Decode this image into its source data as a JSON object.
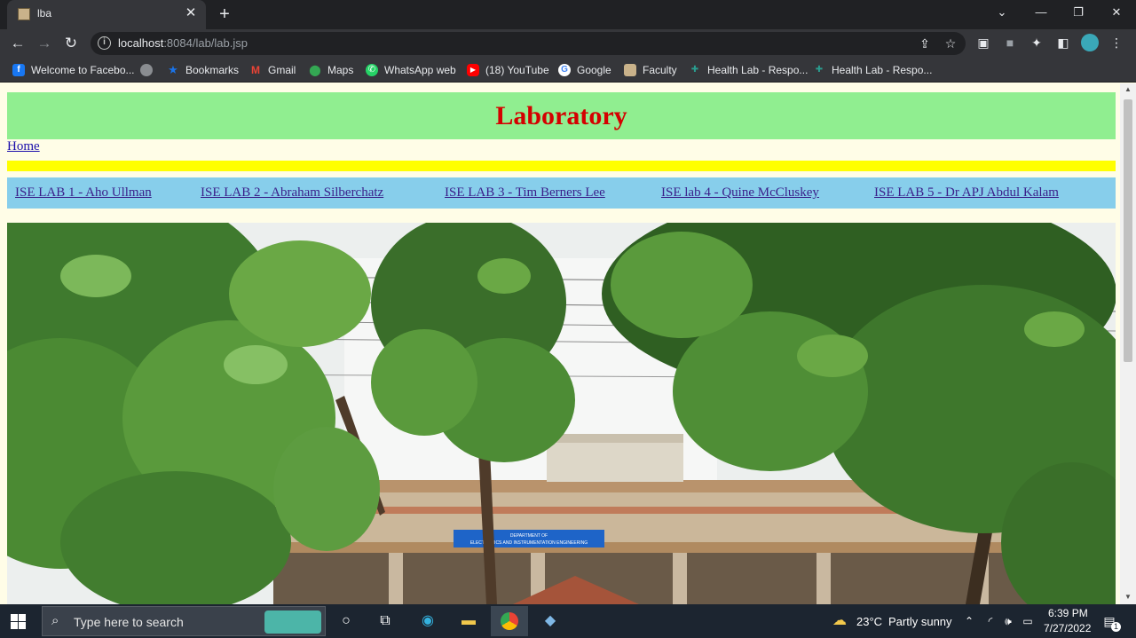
{
  "browser": {
    "tab_title": "lba",
    "url_host": "localhost",
    "url_rest": ":8084/lab/lab.jsp",
    "window_controls": {
      "minimize": "—",
      "maximize": "❐",
      "close": "✕"
    },
    "new_tab": "+",
    "tab_close": "✕"
  },
  "bookmarks": [
    {
      "label": "Welcome to Facebo...",
      "icon": "facebook-icon",
      "color": "#1877f2"
    },
    {
      "label": "",
      "icon": "globe-icon",
      "color": "#8a8d91"
    },
    {
      "label": "Bookmarks",
      "icon": "star-icon",
      "color": "#1a73e8"
    },
    {
      "label": "Gmail",
      "icon": "gmail-icon",
      "color": "#ea4335"
    },
    {
      "label": "Maps",
      "icon": "maps-icon",
      "color": "#34a853"
    },
    {
      "label": "WhatsApp web",
      "icon": "whatsapp-icon",
      "color": "#25d366"
    },
    {
      "label": "(18) YouTube",
      "icon": "youtube-icon",
      "color": "#ff0000"
    },
    {
      "label": "Google",
      "icon": "google-icon",
      "color": "#ffffff"
    },
    {
      "label": "Faculty",
      "icon": "faculty-icon",
      "color": "#c9b28a"
    },
    {
      "label": "Health Lab - Respo...",
      "icon": "health-lab-icon",
      "color": "#2a9d8f"
    },
    {
      "label": "Health Lab - Respo...",
      "icon": "health-lab-icon",
      "color": "#2a9d8f"
    }
  ],
  "page": {
    "title": "Laboratory",
    "home_link": "Home",
    "labs": [
      "ISE LAB 1 - Aho Ullman",
      "ISE LAB 2 - Abraham Silberchatz",
      "ISE LAB 3 - Tim Berners Lee",
      "ISE lab 4 - Quine McCluskey",
      "ISE LAB 5 - Dr APJ Abdul Kalam"
    ],
    "photo_sign": "DEPARTMENT OF ELECTRONICS AND INSTRUMENTATION ENGINEERING",
    "colors": {
      "header_bg": "#90ee90",
      "title": "#d40000",
      "yellow_bar": "#ffff00",
      "nav_bg": "#87ceeb",
      "page_bg": "#fffde7"
    }
  },
  "taskbar": {
    "search_placeholder": "Type here to search",
    "weather_temp": "23°C",
    "weather_desc": "Partly sunny",
    "time": "6:39 PM",
    "date": "7/27/2022",
    "notification_count": "1"
  }
}
